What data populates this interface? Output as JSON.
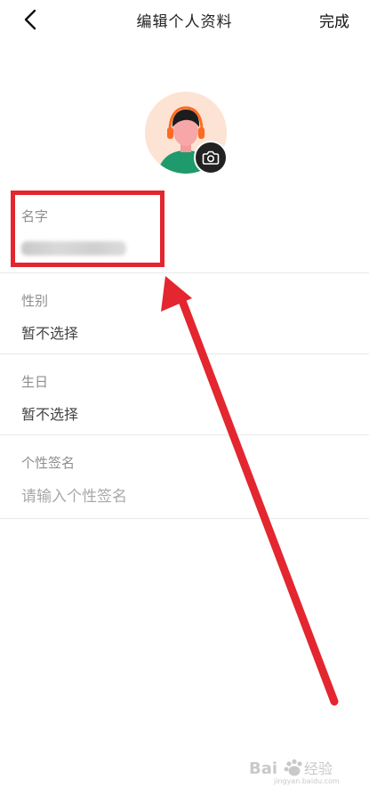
{
  "header": {
    "back_icon": "chevron-left-icon",
    "title": "编辑个人资料",
    "done_label": "完成"
  },
  "avatar": {
    "camera_icon": "camera-icon"
  },
  "fields": {
    "name": {
      "label": "名字"
    },
    "gender": {
      "label": "性别",
      "value": "暂不选择"
    },
    "birthday": {
      "label": "生日",
      "value": "暂不选择"
    },
    "signature": {
      "label": "个性签名",
      "placeholder": "请输入个性签名"
    }
  },
  "annotation": {
    "color": "#e3262f"
  },
  "watermark": {
    "text": "Bai 经验",
    "subtext": "jingyan.baidu.com"
  }
}
